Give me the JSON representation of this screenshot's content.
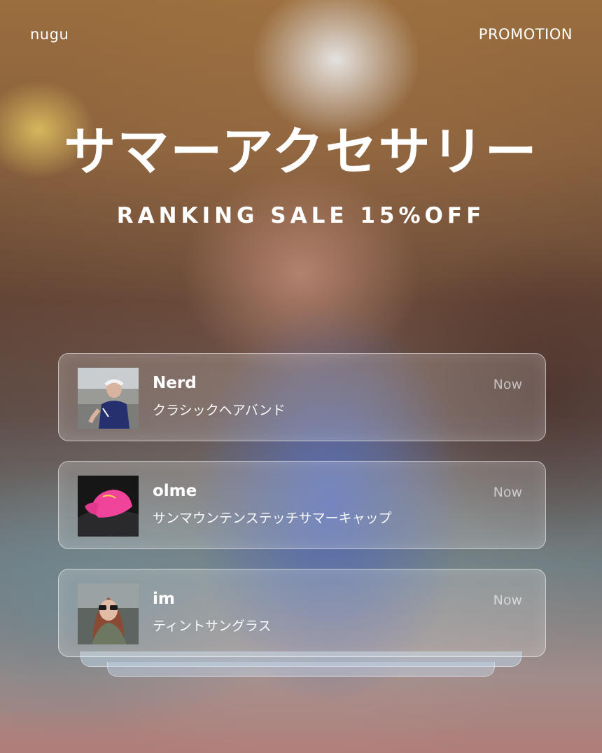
{
  "header": {
    "brand": "nugu",
    "tag": "PROMOTION"
  },
  "hero": {
    "title": "サマーアクセサリー",
    "subtitle": "RANKING SALE 15%OFF"
  },
  "notifications": [
    {
      "title": "Nerd",
      "subtitle": "クラシックヘアバンド",
      "time": "Now",
      "thumb_icon": "person-headband-photo"
    },
    {
      "title": "olme",
      "subtitle": "サンマウンテンステッチサマーキャップ",
      "time": "Now",
      "thumb_icon": "pink-cap-photo"
    },
    {
      "title": "im",
      "subtitle": "ティントサングラス",
      "time": "Now",
      "thumb_icon": "person-sunglasses-photo"
    }
  ]
}
